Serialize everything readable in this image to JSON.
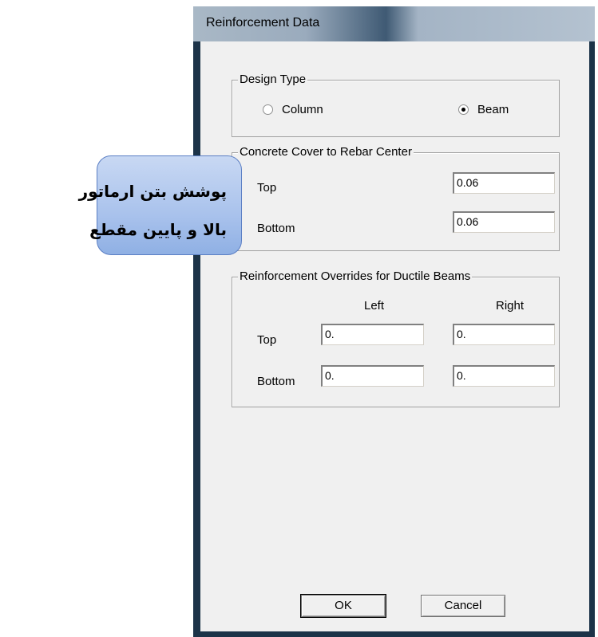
{
  "window": {
    "title": "Reinforcement Data"
  },
  "design_type": {
    "legend": "Design Type",
    "options": [
      {
        "label": "Column",
        "selected": false
      },
      {
        "label": "Beam",
        "selected": true
      }
    ]
  },
  "cover": {
    "legend": "Concrete Cover to Rebar Center",
    "top_label": "Top",
    "top_value": "0.06",
    "bottom_label": "Bottom",
    "bottom_value": "0.06"
  },
  "overrides": {
    "legend": "Reinforcement Overrides for Ductile Beams",
    "left_header": "Left",
    "right_header": "Right",
    "top_label": "Top",
    "bottom_label": "Bottom",
    "top_left": "0.",
    "top_right": "0.",
    "bottom_left": "0.",
    "bottom_right": "0."
  },
  "buttons": {
    "ok": "OK",
    "cancel": "Cancel"
  },
  "callout": {
    "line1": "پوشش بتن ارماتور",
    "line2": "بالا و پایین مقطع"
  }
}
